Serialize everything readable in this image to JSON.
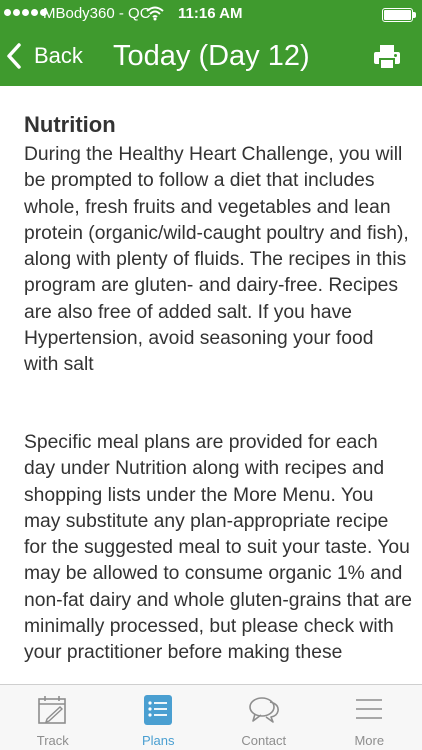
{
  "status_bar": {
    "carrier": "MBody360 - QC",
    "time": "11:16 AM"
  },
  "nav": {
    "back_label": "Back",
    "title": "Today (Day 12)"
  },
  "content": {
    "heading": "Nutrition",
    "paragraphs": [
      "During the Healthy Heart Challenge, you will be prompted to follow a diet that includes whole, fresh fruits and vegetables and lean protein (organic/wild-caught poultry and fish), along with plenty of fluids. The recipes in this program are gluten- and dairy-free. Recipes are also free of added salt. If you have Hypertension, avoid seasoning your food with salt",
      "Specific meal plans are provided for each day under Nutrition along with recipes and shopping lists under the More Menu. You may substitute any plan-appropriate recipe for the suggested meal to suit your taste. You may be allowed to consume organic 1% and non-fat dairy and whole gluten-grains that are minimally processed, but please check with your practitioner before making these"
    ]
  },
  "tabs": [
    {
      "label": "Track",
      "icon": "calendar-edit-icon",
      "active": false
    },
    {
      "label": "Plans",
      "icon": "plans-list-icon",
      "active": true
    },
    {
      "label": "Contact",
      "icon": "chat-bubbles-icon",
      "active": false
    },
    {
      "label": "More",
      "icon": "menu-lines-icon",
      "active": false
    }
  ],
  "colors": {
    "header_green": "#3f9a2e",
    "active_tab_blue": "#4a9fd1",
    "inactive_tab_gray": "#8e8e8e"
  }
}
